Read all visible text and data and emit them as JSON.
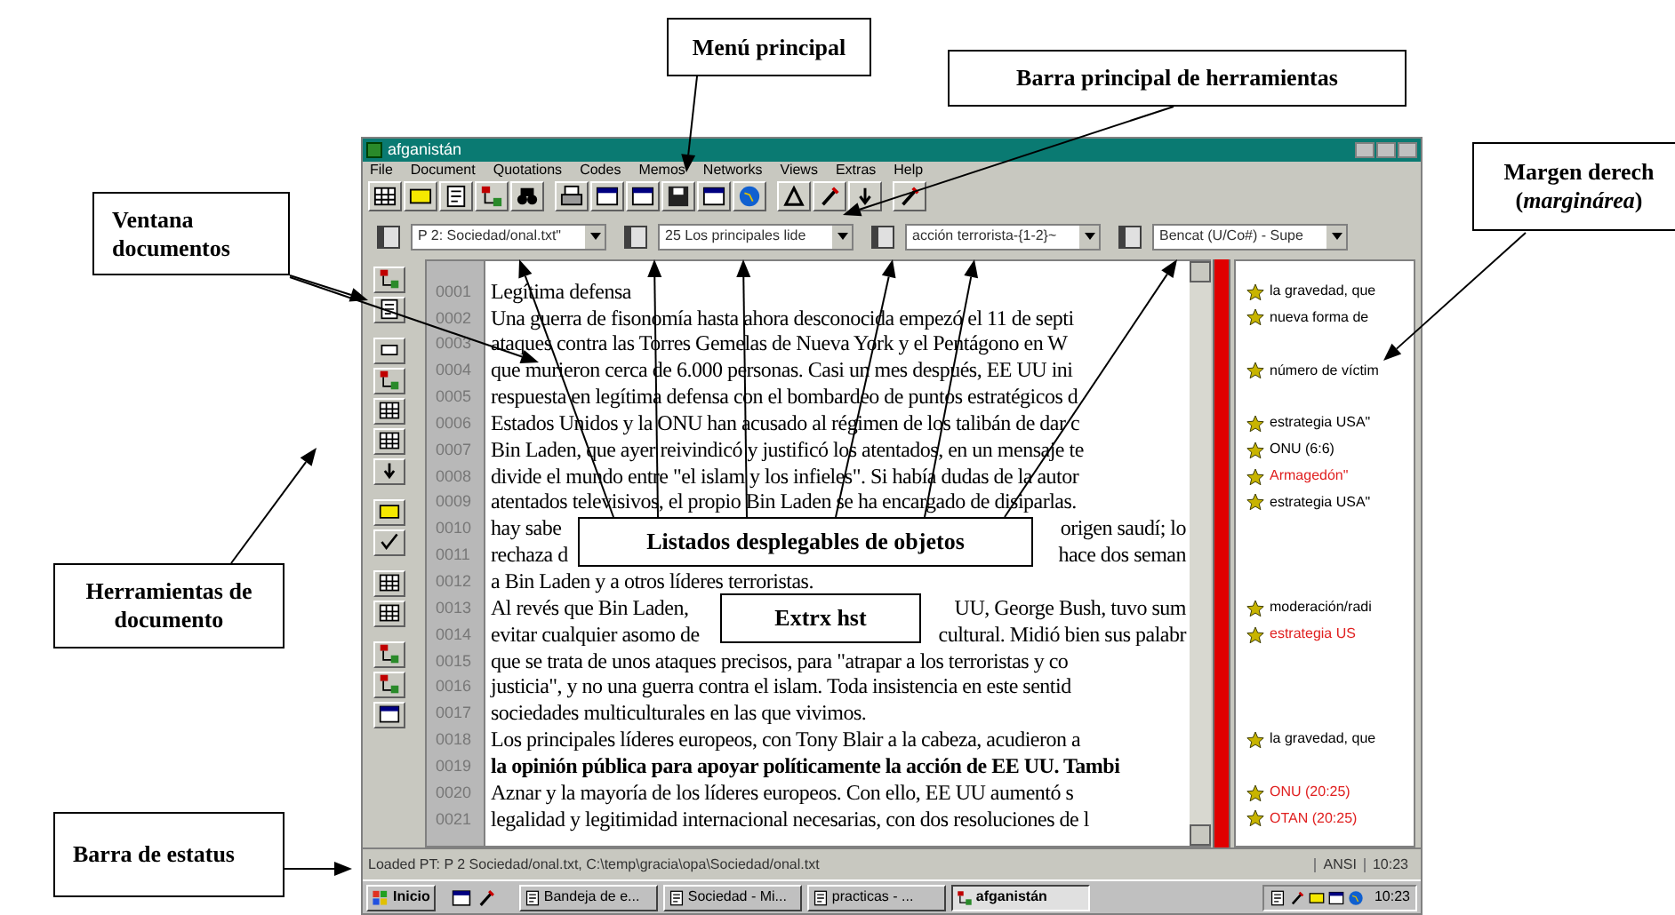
{
  "annotations": [
    {
      "text": "Menú principal"
    },
    {
      "text": "Barra principal de herramientas"
    },
    {
      "text": "Margen derech (*marginárea*)"
    },
    {
      "text": "Ventana documentos"
    },
    {
      "text": "Listados desplegables de objetos"
    },
    {
      "text": "Extrx hst"
    },
    {
      "text": "Herramientas de documento"
    },
    {
      "text": "Barra de estatus"
    }
  ],
  "window": {
    "title": "afganistán",
    "menu": [
      "File",
      "Document",
      "Quotations",
      "Codes",
      "Memos",
      "Networks",
      "Views",
      "Extras",
      "Help"
    ],
    "dropdowns": [
      {
        "value": "P 2: Sociedad/onal.txt\""
      },
      {
        "value": "25 Los principales lide"
      },
      {
        "value": "acción terrorista-{1-2}~"
      },
      {
        "value": "Bencat (U/Co#) - Supe"
      }
    ],
    "lines": [
      {
        "number": "0001",
        "text": "Legítima defensa",
        "codes": [
          {
            "text": "la gravedad, que",
            "color": "#000000"
          }
        ]
      },
      {
        "number": "0002",
        "text": "Una guerra de fisonomía hasta ahora desconocida empezó el 11 de septi",
        "codes": [
          {
            "text": "nueva forma de",
            "color": "#000000"
          }
        ]
      },
      {
        "number": "0003",
        "text": "ataques contra las Torres Gemelas de Nueva York y el Pentágono en W"
      },
      {
        "number": "0004",
        "text": "que murieron cerca de 6.000 personas. Casi un mes después, EE UU ini",
        "codes": [
          {
            "text": "número de víctim",
            "color": "#000000"
          }
        ]
      },
      {
        "number": "0005",
        "text": "respuesta en legítima defensa con el bombardeo de puntos estratégicos d"
      },
      {
        "number": "0006",
        "text": "Estados Unidos y la ONU han acusado al régimen de los talibán de dar c",
        "codes": [
          {
            "text": "estrategia USA\"",
            "color": "#000000"
          }
        ]
      },
      {
        "number": "0007",
        "text": "Bin Laden, que ayer reivindicó y justificó los atentados, en un mensaje te",
        "codes": [
          {
            "text": "ONU (6:6)",
            "color": "#000000"
          }
        ]
      },
      {
        "number": "0008",
        "text": "divide el mundo entre \"el islam y los infieles\". Si había dudas de la autor",
        "codes": [
          {
            "text": "Armagedón\"",
            "color": "#e02020"
          }
        ]
      },
      {
        "number": "0009",
        "text": "atentados televisivos, el propio Bin Laden se ha encargado de disiparlas.",
        "codes": [
          {
            "text": "estrategia USA\"",
            "color": "#000000"
          }
        ]
      },
      {
        "number": "0010",
        "segments": [
          "hay sabe",
          "origen saudí; lo"
        ]
      },
      {
        "number": "0011",
        "segments": [
          "rechaza d",
          "hace dos seman"
        ]
      },
      {
        "number": "0012",
        "text": "a Bin Laden y a otros líderes terroristas."
      },
      {
        "number": "0013",
        "segments": [
          "Al revés que Bin Laden,",
          "UU, George Bush, tuvo sum"
        ],
        "codes": [
          {
            "text": "moderación/radi",
            "color": "#000000"
          }
        ]
      },
      {
        "number": "0014",
        "segments": [
          "evitar cualquier asomo de",
          "cultural. Midió bien sus palabr"
        ],
        "codes": [
          {
            "text": "estrategia US",
            "color": "#e02020"
          }
        ]
      },
      {
        "number": "0015",
        "text": "que se trata de unos ataques precisos, para \"atrapar a los terroristas y co"
      },
      {
        "number": "0016",
        "text": "justicia\", y no una guerra contra el islam. Toda insistencia en este sentid"
      },
      {
        "number": "0017",
        "text": "sociedades multiculturales en las que vivimos."
      },
      {
        "number": "0018",
        "text": "Los principales líderes europeos, con Tony Blair a la cabeza, acudieron a",
        "codes": [
          {
            "text": "la gravedad, que",
            "color": "#000000"
          }
        ]
      },
      {
        "number": "0019",
        "text": "la opinión pública para apoyar políticamente la acción de EE UU. Tambi",
        "bold": true
      },
      {
        "number": "0020",
        "text": "Aznar y la mayoría de los líderes europeos. Con ello, EE UU aumentó s",
        "codes": [
          {
            "text": "ONU (20:25)",
            "color": "#e02020"
          }
        ]
      },
      {
        "number": "0021",
        "text": "legalidad y legitimidad internacional necesarias, con dos resoluciones de l",
        "codes": [
          {
            "text": "OTAN (20:25)",
            "color": "#e02020"
          }
        ]
      }
    ],
    "status_bar": {
      "text": "Loaded PT: P 2 Sociedad/onal.txt, C:\\temp\\gracia\\opa\\Sociedad/onal.txt",
      "encoding": "ANSI",
      "time": "10:23"
    }
  },
  "taskbar": {
    "start": "Inicio",
    "tasks": [
      {
        "label": "Bandeja de e...",
        "selected": false
      },
      {
        "label": "Sociedad - Mi...",
        "selected": false
      },
      {
        "label": "practicas - ...",
        "selected": false
      },
      {
        "label": "afganistán",
        "selected": true
      }
    ],
    "clock": "10:23"
  }
}
